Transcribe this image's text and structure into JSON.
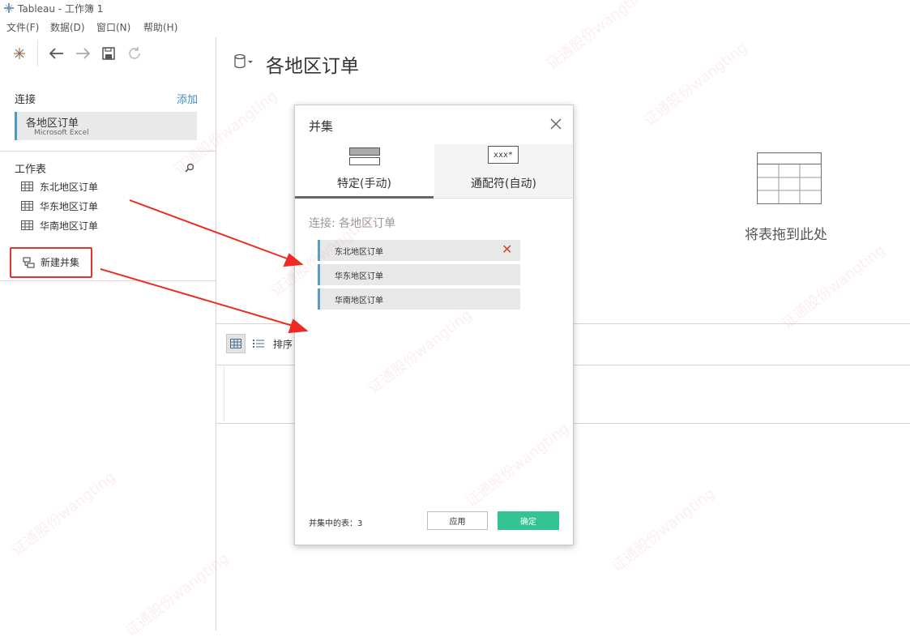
{
  "window": {
    "title": "Tableau - 工作簿 1"
  },
  "menu": [
    "文件(F)",
    "数据(D)",
    "窗口(N)",
    "帮助(H)"
  ],
  "left": {
    "connections_label": "连接",
    "add_label": "添加",
    "connection": {
      "name": "各地区订单",
      "type": "Microsoft Excel"
    },
    "sheets_label": "工作表",
    "sheets": [
      "东北地区订单",
      "华东地区订单",
      "华南地区订单"
    ],
    "new_union_label": "新建并集"
  },
  "main": {
    "title": "各地区订单",
    "drop_text": "将表拖到此处",
    "sort_label": "排序"
  },
  "dialog": {
    "title": "并集",
    "tabs": [
      "特定(手动)",
      "通配符(自动)"
    ],
    "wildcard_icon_text": "xxx*",
    "connection_label": "连接: 各地区订单",
    "tables": [
      "东北地区订单",
      "华东地区订单",
      "华南地区订单"
    ],
    "footer": "并集中的表：3",
    "apply_label": "应用",
    "ok_label": "确定"
  },
  "colors": {
    "accent_blue": "#4e9bbf",
    "ok_green": "#33c491",
    "highlight_red": "#e8332a"
  },
  "watermark": "证通股份wangting"
}
